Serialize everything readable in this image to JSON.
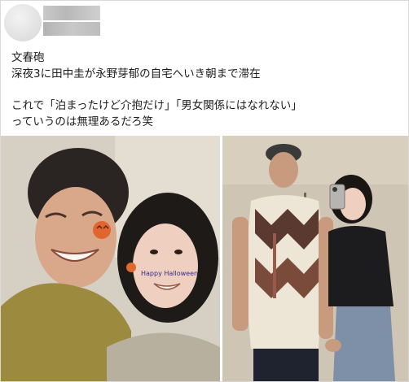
{
  "post": {
    "author_name": "",
    "lines": [
      "文春砲",
      "深夜3に田中圭が永野芽郁の自宅へいき朝まで滞在",
      "",
      "これで「泊まったけど介抱だけ」「男女関係にはなれない」",
      "っていうのは無理あるだろ笑"
    ]
  },
  "photos": [
    {
      "description_icon": "selfie-photo-icon",
      "sticker_text": "Happy Halloween"
    },
    {
      "description_icon": "mirror-selfie-photo-icon"
    }
  ]
}
